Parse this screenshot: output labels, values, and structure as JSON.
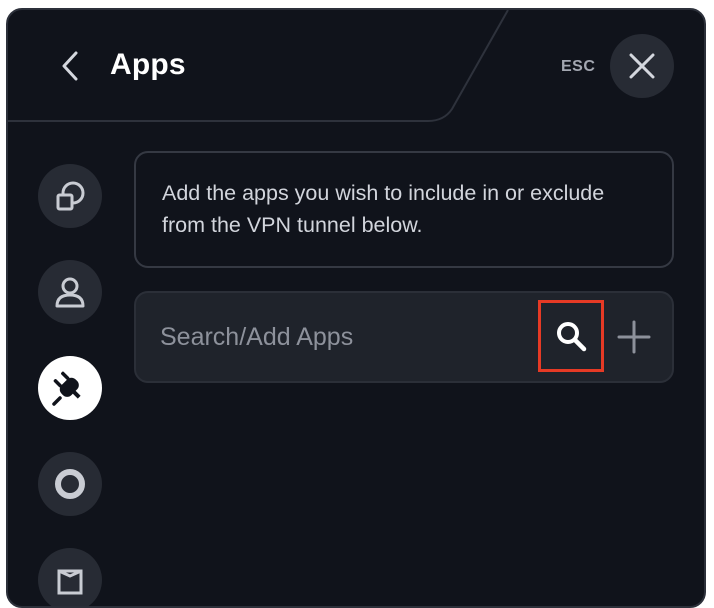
{
  "header": {
    "title": "Apps",
    "esc_label": "ESC"
  },
  "sidebar": {
    "items": [
      {
        "name": "general",
        "icon": "overlapping-squares-icon",
        "active": false
      },
      {
        "name": "account",
        "icon": "user-icon",
        "active": false
      },
      {
        "name": "split-tunneling",
        "icon": "plug-icon",
        "active": true
      },
      {
        "name": "connection",
        "icon": "ring-icon",
        "active": false
      },
      {
        "name": "other",
        "icon": "box-icon",
        "active": false
      }
    ]
  },
  "main": {
    "description": "Add the apps you wish to include in or exclude from the VPN tunnel below.",
    "search": {
      "placeholder": "Search/Add Apps",
      "value": ""
    }
  },
  "colors": {
    "background": "#10131b",
    "panel": "#1f232b",
    "button": "#272b34",
    "highlight": "#e63a25",
    "text": "#ffffff",
    "muted_text": "#8d919b"
  },
  "icons": {
    "back": "chevron-left-icon",
    "close": "close-icon",
    "search": "search-icon",
    "add": "plus-icon"
  }
}
